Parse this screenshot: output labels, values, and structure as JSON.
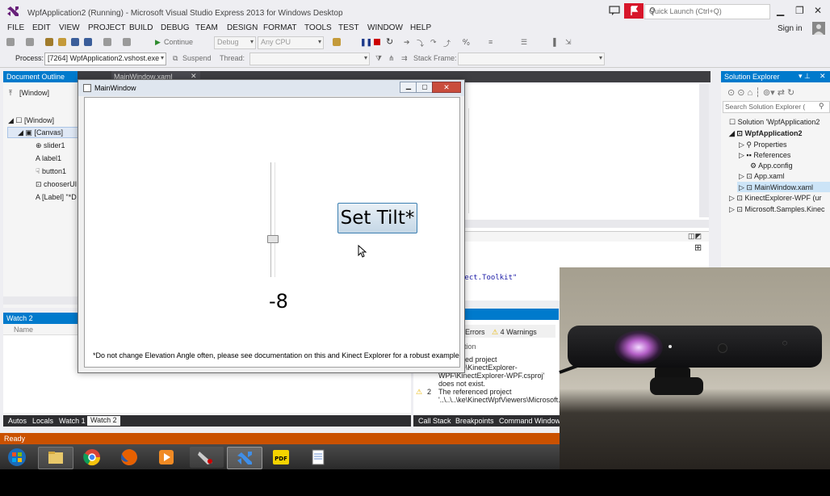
{
  "window": {
    "title": "WpfApplication2 (Running) - Microsoft Visual Studio Express 2013 for Windows Desktop",
    "quick_launch_placeholder": "Quick Launch (Ctrl+Q)",
    "sign_in": "Sign in"
  },
  "menu": [
    "FILE",
    "EDIT",
    "VIEW",
    "PROJECT",
    "BUILD",
    "DEBUG",
    "TEAM",
    "DESIGN",
    "FORMAT",
    "TOOLS",
    "TEST",
    "WINDOW",
    "HELP"
  ],
  "toolbar": {
    "continue_label": "Continue",
    "config_value": "Debug",
    "platform_value": "Any CPU",
    "process_label": "Process:",
    "process_value": "[7264] WpfApplication2.vshost.exe",
    "suspend_label": "Suspend",
    "thread_label": "Thread:",
    "stack_frame_label": "Stack Frame:"
  },
  "document_outline": {
    "header": "Document Outline",
    "root": "[Window]",
    "items": [
      "[Window]",
      "[Canvas]",
      "slider1",
      "label1",
      "button1",
      "chooserUI",
      "[Label] \"*D"
    ]
  },
  "editor": {
    "tab": "MainWindow.xaml",
    "code_lines": [
      "nect.Toolkit\""
    ]
  },
  "main_window": {
    "title": "MainWindow",
    "button_label": "Set Tilt*",
    "slider_value": "-8",
    "note": "*Do not change Elevation Angle often, please see documentation on this and Kinect Explorer for a robust example"
  },
  "solution_explorer": {
    "header": "Solution Explorer",
    "search_placeholder": "Search Solution Explorer (",
    "items": [
      "Solution 'WpfApplication2",
      "WpfApplication2",
      "Properties",
      "References",
      "App.config",
      "App.xaml",
      "MainWindow.xaml",
      "KinectExplorer-WPF (ur",
      "Microsoft.Samples.Kinec"
    ]
  },
  "watch": {
    "header": "Watch 2",
    "column_name": "Name"
  },
  "error_list": {
    "errors_tab": "Errors",
    "warnings_tab": "4 Warnings",
    "column_description": "tion",
    "rows": [
      {
        "num": "",
        "text": "referenced project '..\\..\\..\\ke\\KinectExplorer-WPF\\KinectExplorer-WPF.csproj' does not exist."
      },
      {
        "num": "2",
        "text": "The referenced project '..\\..\\..\\ke\\KinectWpfViewers\\Microsoft.Samples.Kinect.WpfViewer"
      }
    ]
  },
  "bottom_tabs_left": [
    "Autos",
    "Locals",
    "Watch 1",
    "Watch 2"
  ],
  "bottom_tabs_right": [
    "Call Stack",
    "Breakpoints",
    "Command Window"
  ],
  "status": "Ready",
  "taskbar_apps": [
    "start",
    "explorer",
    "chrome",
    "firefox",
    "media-player",
    "snipping-tool",
    "visual-studio",
    "pdf",
    "notepad"
  ],
  "colors": {
    "vs_blue": "#007acc",
    "status_orange": "#ca5100",
    "error_red": "#d7162a"
  }
}
